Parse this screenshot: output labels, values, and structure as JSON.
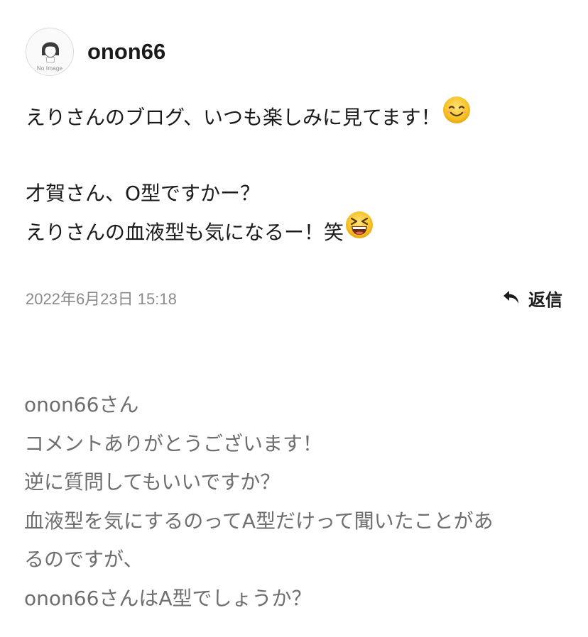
{
  "comment": {
    "author": {
      "username": "onon66",
      "avatar_caption": "No Image",
      "avatar_icon": "no-image-avatar-icon"
    },
    "body": {
      "line1": "えりさんのブログ、いつも楽しみに見てます！",
      "line1_emoji": "smiling-face-emoji",
      "line2": "才賀さん、O型ですかー？",
      "line3": "えりさんの血液型も気になるー！笑",
      "line3_emoji": "grinning-squinting-face-emoji"
    },
    "timestamp": "2022年6月23日 15:18",
    "reply_button": {
      "label": "返信",
      "icon": "reply-arrow-icon"
    }
  },
  "reply": {
    "lines": [
      "onon66さん",
      "コメントありがとうございます！",
      "逆に質問してもいいですか？",
      "血液型を気にするのってA型だけって聞いたことがあ",
      "るのですが、",
      "onon66さんはA型でしょうか？"
    ]
  },
  "colors": {
    "primary_text": "#1a1a1a",
    "secondary_text": "#8a8a8a",
    "reply_text": "#6e6e6e",
    "emoji_yellow": "#f7c325"
  }
}
